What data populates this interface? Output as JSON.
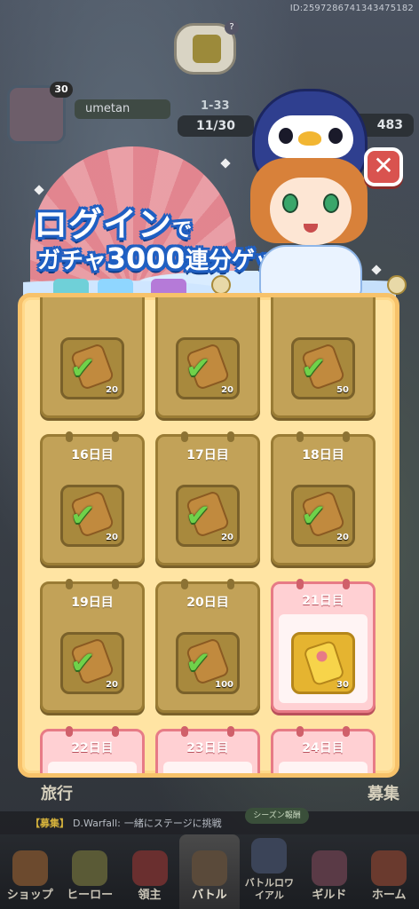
{
  "header": {
    "player_id": "ID:2597286741343475182",
    "player_level": "30",
    "username": "umetan",
    "stage": "1-33",
    "stamina": "11/30",
    "gems": "483"
  },
  "banner": {
    "title_main": "ログイン",
    "title_suffix": "で",
    "subtitle_prefix": "ガチャ",
    "subtitle_number": "3000",
    "subtitle_suffix": "連分ゲット",
    "close_label": "✕"
  },
  "calendar": {
    "rows": [
      [
        {
          "day": "",
          "qty": "20",
          "status": "claimed"
        },
        {
          "day": "",
          "qty": "20",
          "status": "claimed"
        },
        {
          "day": "",
          "qty": "50",
          "status": "claimed"
        }
      ],
      [
        {
          "day": "16日目",
          "qty": "20",
          "status": "claimed"
        },
        {
          "day": "17日目",
          "qty": "20",
          "status": "claimed"
        },
        {
          "day": "18日目",
          "qty": "20",
          "status": "claimed"
        }
      ],
      [
        {
          "day": "19日目",
          "qty": "20",
          "status": "claimed"
        },
        {
          "day": "20日目",
          "qty": "100",
          "status": "claimed"
        },
        {
          "day": "21日目",
          "qty": "30",
          "status": "today"
        }
      ],
      [
        {
          "day": "22日目",
          "qty": "",
          "status": "upcoming"
        },
        {
          "day": "23日目",
          "qty": "",
          "status": "upcoming"
        },
        {
          "day": "24日目",
          "qty": "",
          "status": "upcoming"
        }
      ]
    ]
  },
  "background_labels": {
    "travel": "旅行",
    "recruit": "募集"
  },
  "chat": {
    "tag": "【募集】",
    "sender": "D.Warfall:",
    "message": "一緒にステージに挑戦",
    "season_pill": "シーズン報酬"
  },
  "nav": {
    "items": [
      {
        "label": "ショップ",
        "icon": "shop-icon"
      },
      {
        "label": "ヒーロー",
        "icon": "hero-icon"
      },
      {
        "label": "領主",
        "icon": "lord-icon"
      },
      {
        "label": "バトル",
        "icon": "battle-icon"
      },
      {
        "label": "バトルロワイアル",
        "icon": "royale-icon"
      },
      {
        "label": "ギルド",
        "icon": "guild-icon"
      },
      {
        "label": "ホーム",
        "icon": "home-icon"
      }
    ],
    "active_index": 3
  },
  "colors": {
    "claimed_card": "#c2a258",
    "today_card": "#ffd0d3",
    "check": "#6fd24a",
    "banner_outline": "#1f5fc2",
    "close_button": "#d9534f"
  }
}
